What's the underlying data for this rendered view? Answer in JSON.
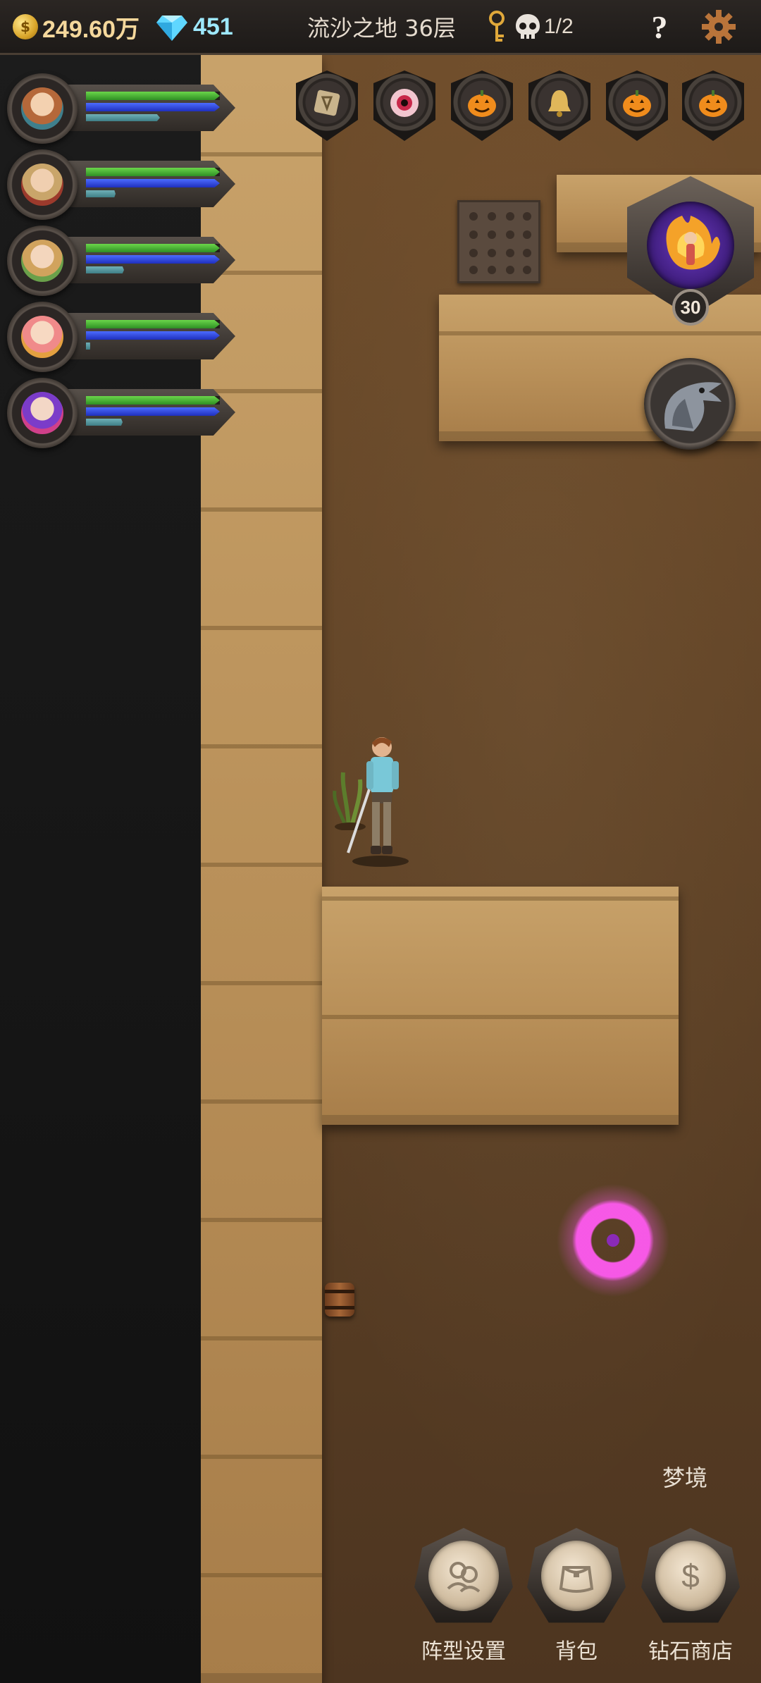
{
  "topbar": {
    "gold": "249.60万",
    "diamonds": "451",
    "location": "流沙之地 36层",
    "kills": "1/2",
    "help_glyph": "?"
  },
  "party": [
    {
      "name": "hero-1",
      "hp": 1.0,
      "mp": 1.0,
      "xp": 0.55
    },
    {
      "name": "hero-2",
      "hp": 1.0,
      "mp": 1.0,
      "xp": 0.22
    },
    {
      "name": "hero-3",
      "hp": 1.0,
      "mp": 1.0,
      "xp": 0.28
    },
    {
      "name": "hero-4",
      "hp": 1.0,
      "mp": 1.0,
      "xp": 0.03
    },
    {
      "name": "hero-5",
      "hp": 1.0,
      "mp": 1.0,
      "xp": 0.27
    }
  ],
  "items": [
    {
      "icon": "rune-stone-icon"
    },
    {
      "icon": "eye-icon"
    },
    {
      "icon": "pumpkin-icon"
    },
    {
      "icon": "bell-icon"
    },
    {
      "icon": "pumpkin-icon"
    },
    {
      "icon": "pumpkin-icon"
    }
  ],
  "boss": {
    "level": "30",
    "icon": "fire-dancer-icon"
  },
  "companion": {
    "icon": "crow-icon"
  },
  "dream_label": "梦境",
  "menu": [
    {
      "label": "阵型设置",
      "icon": "formation-icon"
    },
    {
      "label": "背包",
      "icon": "bag-icon"
    },
    {
      "label": "钻石商店",
      "icon": "dollar-icon"
    }
  ],
  "colors": {
    "gold": "#f5d89c",
    "diamond": "#9ee9ff",
    "hp": "#3fb02f",
    "mp": "#2f45dd",
    "xp": "#5f9ea6",
    "portal": "#ff5af0"
  }
}
